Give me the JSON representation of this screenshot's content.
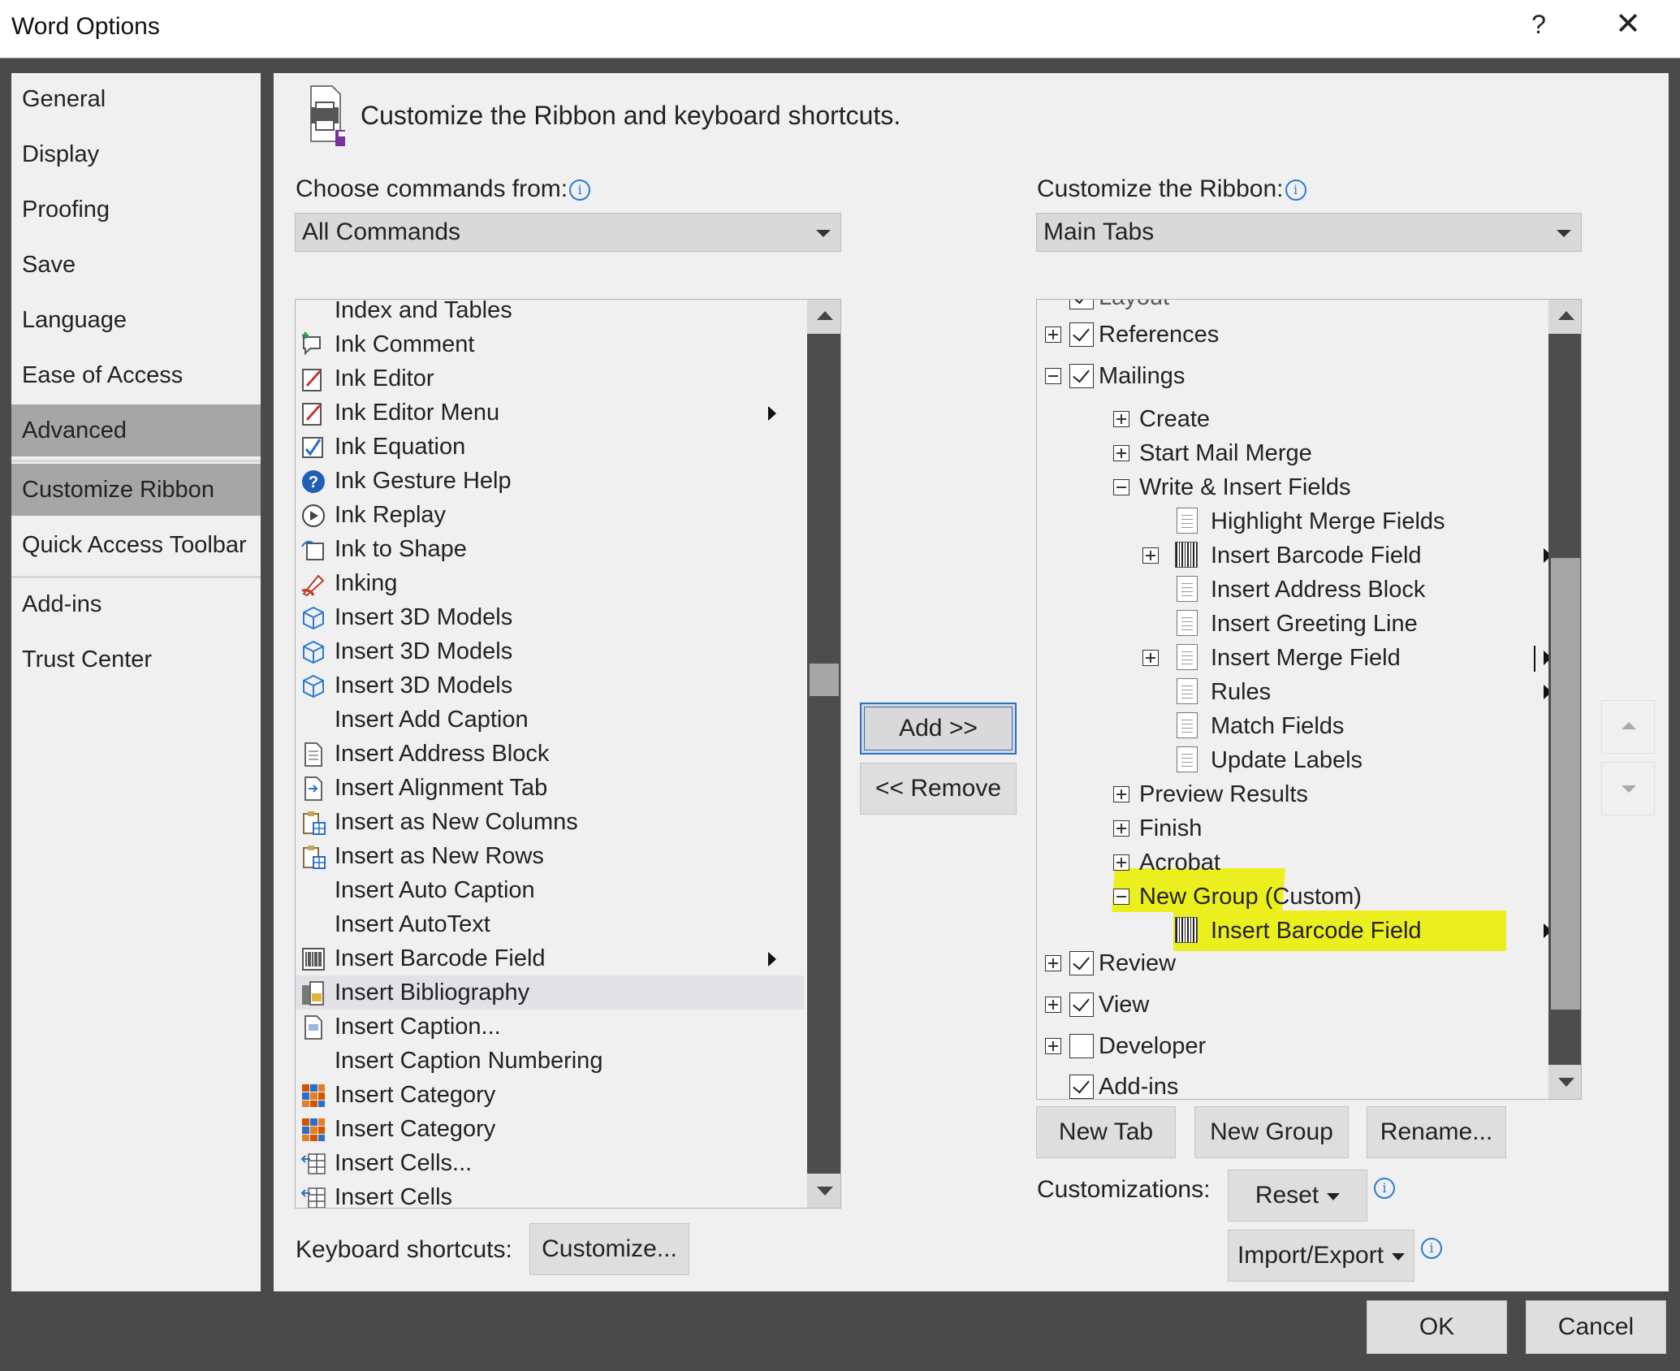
{
  "window": {
    "title": "Word Options",
    "help": "?",
    "close": "✕"
  },
  "nav": {
    "items": [
      "General",
      "Display",
      "Proofing",
      "Save",
      "Language",
      "Ease of Access",
      "Advanced",
      "Customize Ribbon",
      "Quick Access Toolbar",
      "Add-ins",
      "Trust Center"
    ],
    "selected": "Customize Ribbon"
  },
  "header": {
    "text": "Customize the Ribbon and keyboard shortcuts."
  },
  "left": {
    "label": "Choose commands from:",
    "combo_value": "All Commands",
    "commands": [
      {
        "label": "Index and Tables",
        "icon": "none"
      },
      {
        "label": "Ink Comment",
        "icon": "ink-comment-icon"
      },
      {
        "label": "Ink Editor",
        "icon": "ink-editor-icon"
      },
      {
        "label": "Ink Editor Menu",
        "icon": "ink-editor-icon",
        "submenu": true
      },
      {
        "label": "Ink Equation",
        "icon": "ink-equation-icon"
      },
      {
        "label": "Ink Gesture Help",
        "icon": "help-icon"
      },
      {
        "label": "Ink Replay",
        "icon": "replay-icon"
      },
      {
        "label": "Ink to Shape",
        "icon": "shape-icon"
      },
      {
        "label": "Inking",
        "icon": "pen-icon"
      },
      {
        "label": "Insert 3D Models",
        "icon": "cube-icon"
      },
      {
        "label": "Insert 3D Models",
        "icon": "cube-icon"
      },
      {
        "label": "Insert 3D Models",
        "icon": "cube-icon"
      },
      {
        "label": "Insert Add Caption",
        "icon": "none"
      },
      {
        "label": "Insert Address Block",
        "icon": "doc-icon"
      },
      {
        "label": "Insert Alignment Tab",
        "icon": "align-tab-icon"
      },
      {
        "label": "Insert as New Columns",
        "icon": "clipboard-icon"
      },
      {
        "label": "Insert as New Rows",
        "icon": "clipboard-icon"
      },
      {
        "label": "Insert Auto Caption",
        "icon": "none"
      },
      {
        "label": "Insert AutoText",
        "icon": "none"
      },
      {
        "label": "Insert Barcode Field",
        "icon": "barcode-icon",
        "submenu": true
      },
      {
        "label": "Insert Bibliography",
        "icon": "bibliography-icon",
        "selected": true
      },
      {
        "label": "Insert Caption...",
        "icon": "caption-icon"
      },
      {
        "label": "Insert Caption Numbering",
        "icon": "none"
      },
      {
        "label": "Insert Category",
        "icon": "category-icon"
      },
      {
        "label": "Insert Category",
        "icon": "category-icon"
      },
      {
        "label": "Insert Cells...",
        "icon": "cells-icon"
      },
      {
        "label": "Insert Cells",
        "icon": "cells-icon"
      }
    ]
  },
  "middle": {
    "add": "Add >>",
    "remove": "<< Remove"
  },
  "right": {
    "label": "Customize the Ribbon:",
    "combo_value": "Main Tabs",
    "tree": {
      "partial_top": "Layout",
      "references": "References",
      "mailings": "Mailings",
      "create": "Create",
      "start_mail_merge": "Start Mail Merge",
      "write_insert_fields": "Write & Insert Fields",
      "highlight_merge_fields": "Highlight Merge Fields",
      "insert_barcode_field": "Insert Barcode Field",
      "insert_address_block": "Insert Address Block",
      "insert_greeting_line": "Insert Greeting Line",
      "insert_merge_field": "Insert Merge Field",
      "rules": "Rules",
      "match_fields": "Match Fields",
      "update_labels": "Update Labels",
      "preview_results": "Preview Results",
      "finish": "Finish",
      "acrobat": "Acrobat",
      "new_group": "New Group (Custom)",
      "new_group_item": "Insert Barcode Field",
      "review": "Review",
      "view": "View",
      "developer": "Developer",
      "addins": "Add-ins"
    },
    "new_tab": "New Tab",
    "new_group": "New Group",
    "rename": "Rename...",
    "customizations_label": "Customizations:",
    "reset": "Reset",
    "import_export": "Import/Export"
  },
  "keyboard": {
    "label": "Keyboard shortcuts:",
    "button": "Customize..."
  },
  "footer": {
    "ok": "OK",
    "cancel": "Cancel"
  },
  "colors": {
    "highlight": "#ecef1e",
    "selected_nav": "#a6a6a6",
    "accent": "#2a6ec9"
  }
}
